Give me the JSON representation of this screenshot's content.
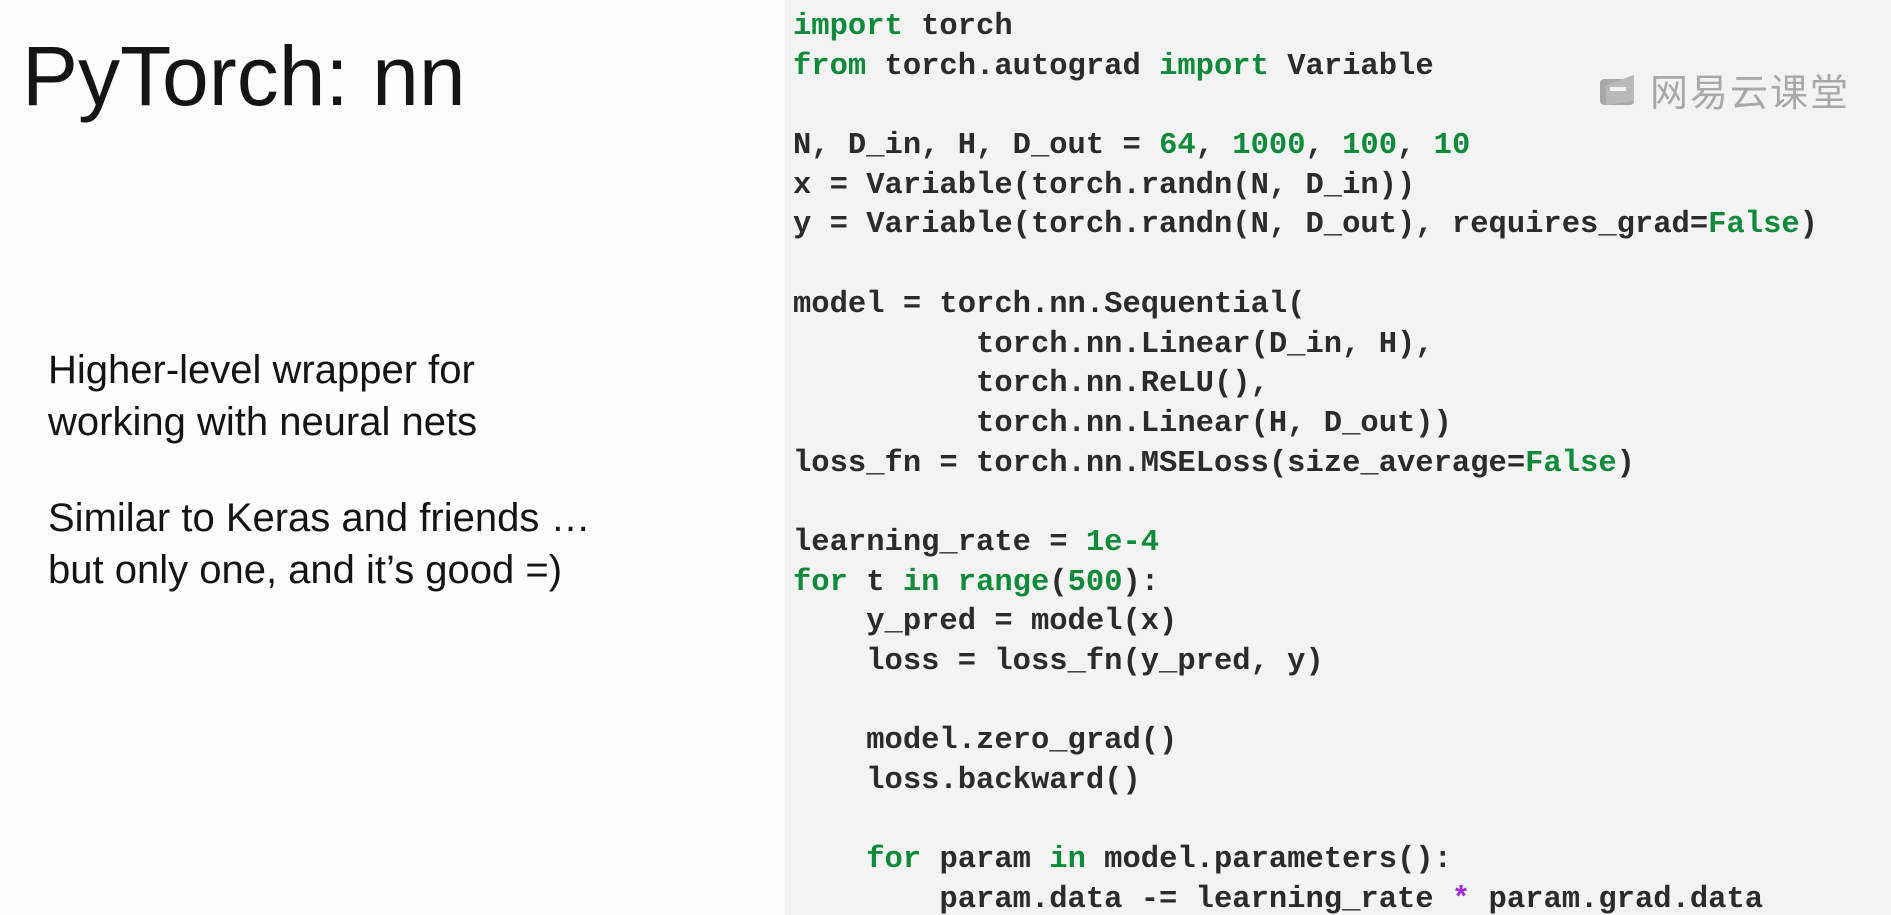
{
  "slide": {
    "title": "PyTorch: nn",
    "bullets": [
      {
        "lines": [
          "Higher-level wrapper for",
          "working with neural nets"
        ]
      },
      {
        "lines": [
          "Similar to Keras and friends …",
          "but only one, and it’s good =)"
        ]
      }
    ]
  },
  "code": {
    "lines": [
      [
        {
          "t": "import",
          "c": "kw"
        },
        {
          "t": " torch",
          "c": "text"
        }
      ],
      [
        {
          "t": "from",
          "c": "kw"
        },
        {
          "t": " torch.autograd ",
          "c": "text"
        },
        {
          "t": "import",
          "c": "kw"
        },
        {
          "t": " Variable",
          "c": "text"
        }
      ],
      [],
      [
        {
          "t": "N, D_in, H, D_out = ",
          "c": "text"
        },
        {
          "t": "64",
          "c": "num"
        },
        {
          "t": ", ",
          "c": "text"
        },
        {
          "t": "1000",
          "c": "num"
        },
        {
          "t": ", ",
          "c": "text"
        },
        {
          "t": "100",
          "c": "num"
        },
        {
          "t": ", ",
          "c": "text"
        },
        {
          "t": "10",
          "c": "num"
        }
      ],
      [
        {
          "t": "x = Variable(torch.randn(N, D_in))",
          "c": "text"
        }
      ],
      [
        {
          "t": "y = Variable(torch.randn(N, D_out), requires_grad=",
          "c": "text"
        },
        {
          "t": "False",
          "c": "kw"
        },
        {
          "t": ")",
          "c": "text"
        }
      ],
      [],
      [
        {
          "t": "model = torch.nn.Sequential(",
          "c": "text"
        }
      ],
      [
        {
          "t": "          torch.nn.Linear(D_in, H),",
          "c": "text"
        }
      ],
      [
        {
          "t": "          torch.nn.ReLU(),",
          "c": "text"
        }
      ],
      [
        {
          "t": "          torch.nn.Linear(H, D_out))",
          "c": "text"
        }
      ],
      [
        {
          "t": "loss_fn = torch.nn.MSELoss(size_average=",
          "c": "text"
        },
        {
          "t": "False",
          "c": "kw"
        },
        {
          "t": ")",
          "c": "text"
        }
      ],
      [],
      [
        {
          "t": "learning_rate = ",
          "c": "text"
        },
        {
          "t": "1e-4",
          "c": "num"
        }
      ],
      [
        {
          "t": "for",
          "c": "kw"
        },
        {
          "t": " t ",
          "c": "text"
        },
        {
          "t": "in",
          "c": "kw"
        },
        {
          "t": " ",
          "c": "text"
        },
        {
          "t": "range",
          "c": "kw"
        },
        {
          "t": "(",
          "c": "text"
        },
        {
          "t": "500",
          "c": "num"
        },
        {
          "t": "):",
          "c": "text"
        }
      ],
      [
        {
          "t": "    y_pred = model(x)",
          "c": "text"
        }
      ],
      [
        {
          "t": "    loss = loss_fn(y_pred, y)",
          "c": "text"
        }
      ],
      [],
      [
        {
          "t": "    model.zero_grad()",
          "c": "text"
        }
      ],
      [
        {
          "t": "    loss.backward()",
          "c": "text"
        }
      ],
      [],
      [
        {
          "t": "    ",
          "c": "text"
        },
        {
          "t": "for",
          "c": "kw"
        },
        {
          "t": " param ",
          "c": "text"
        },
        {
          "t": "in",
          "c": "kw"
        },
        {
          "t": " model.parameters():",
          "c": "text"
        }
      ],
      [
        {
          "t": "        param.data -= learning_rate ",
          "c": "text"
        },
        {
          "t": "*",
          "c": "op"
        },
        {
          "t": " param.grad.data",
          "c": "text"
        }
      ]
    ]
  },
  "watermark": {
    "text": "网易云课堂",
    "icon": "netease-cloud-classroom-logo-icon"
  },
  "colors": {
    "keyword": "#0f8a3a",
    "number": "#0f8a3a",
    "operator": "#a12bd6",
    "code_text": "#2b2b2b",
    "code_background": "#f3f3f3"
  }
}
